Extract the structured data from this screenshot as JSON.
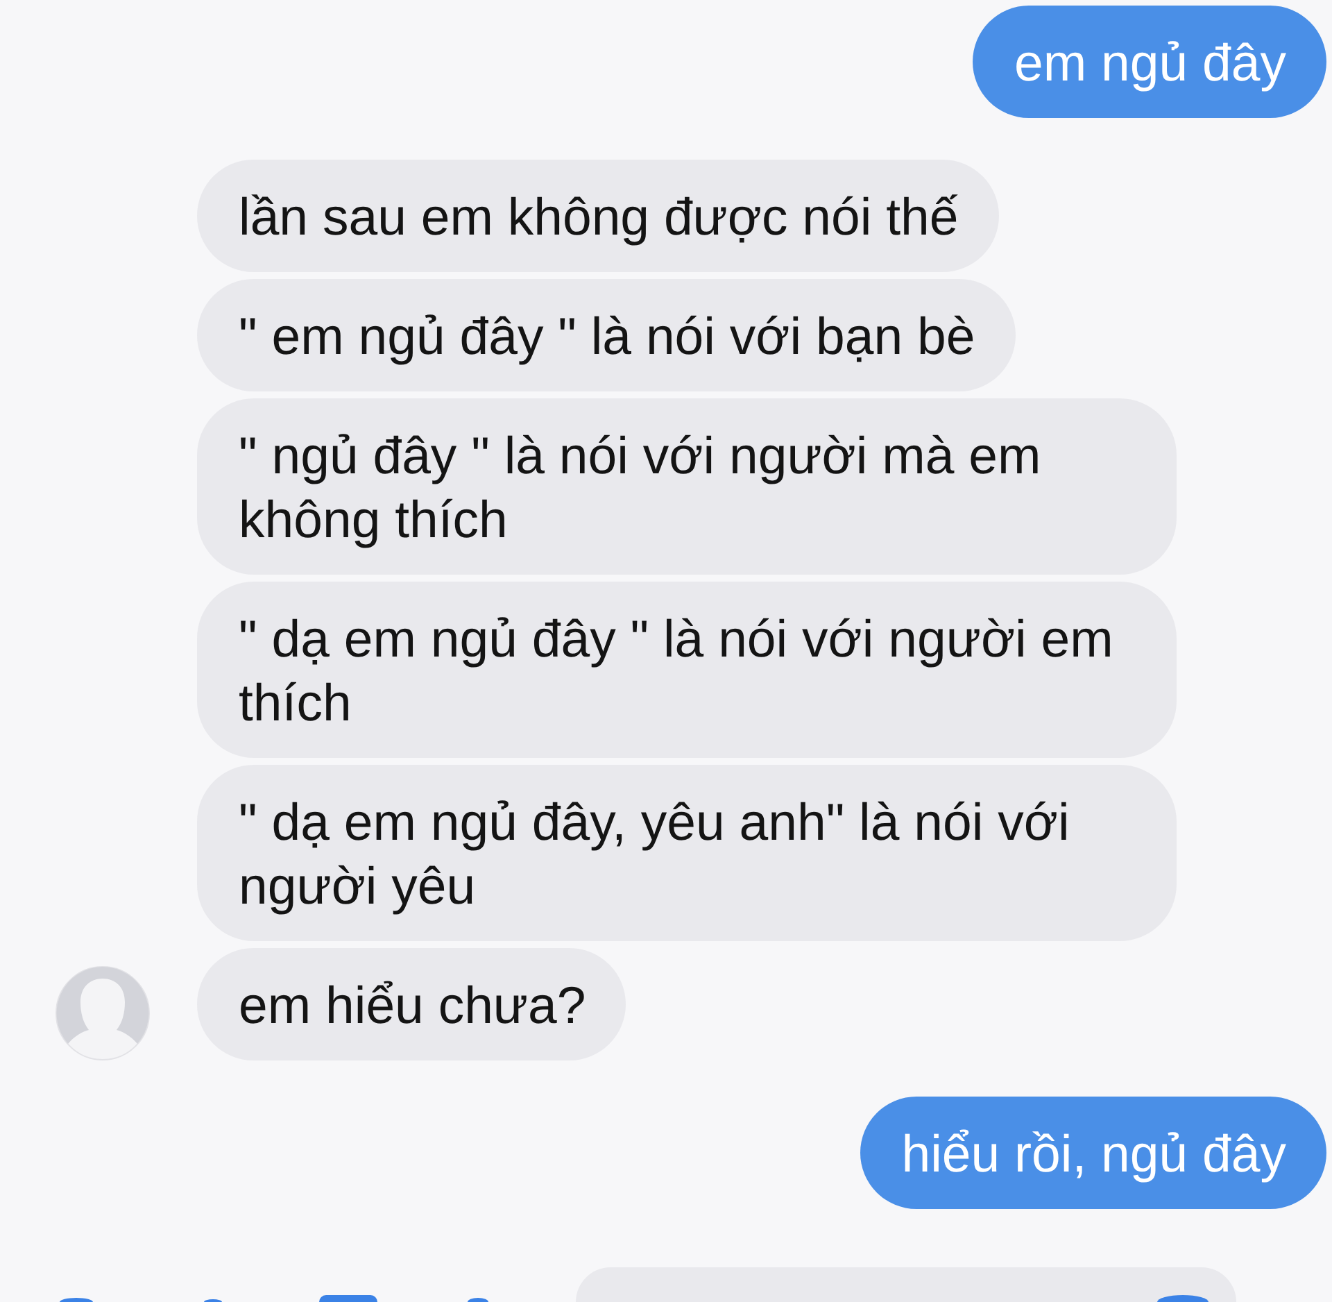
{
  "messages": [
    {
      "kind": "sent",
      "text": "em ngủ đây",
      "avatar": false
    },
    {
      "kind": "received",
      "text": "lần sau em không được nói thế",
      "avatar": false
    },
    {
      "kind": "received",
      "text": "\" em ngủ đây \" là nói với bạn bè",
      "avatar": false
    },
    {
      "kind": "received",
      "text": "\" ngủ đây \" là nói với người mà em không thích",
      "avatar": false
    },
    {
      "kind": "received",
      "text": "\" dạ em ngủ đây \" là nói với người em thích",
      "avatar": false
    },
    {
      "kind": "received",
      "text": "\" dạ em ngủ đây, yêu anh\" là nói với người yêu",
      "avatar": false
    },
    {
      "kind": "received",
      "text": "em hiểu chưa?",
      "avatar": true
    },
    {
      "kind": "sent",
      "text": "hiểu rồi, ngủ đây",
      "avatar": false
    }
  ]
}
